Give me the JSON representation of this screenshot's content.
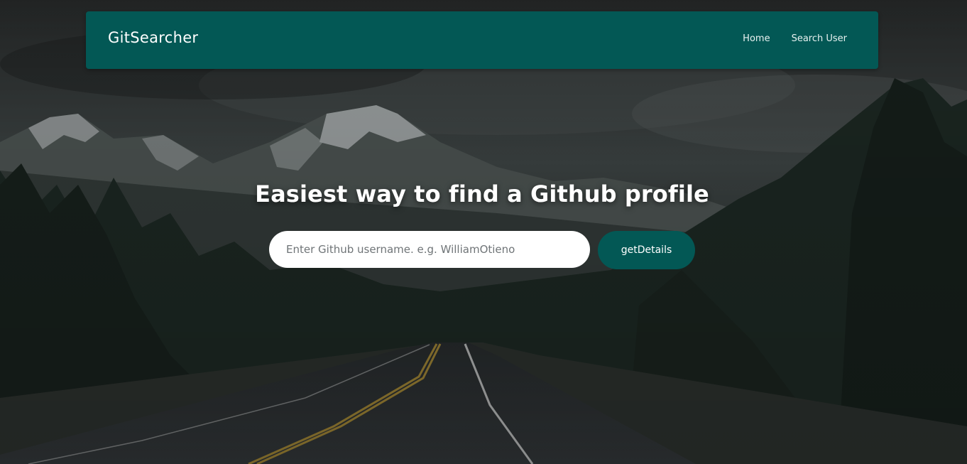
{
  "navbar": {
    "brand": "GitSearcher",
    "links": [
      {
        "label": "Home"
      },
      {
        "label": "Search User"
      }
    ]
  },
  "hero": {
    "headline": "Easiest way to find a Github profile",
    "background": "mountain-road-landscape"
  },
  "search": {
    "placeholder": "Enter Github username. e.g. WilliamOtieno",
    "value": "",
    "button_label": "getDetails"
  },
  "colors": {
    "accent": "#035855",
    "text_light": "#ffffff"
  }
}
